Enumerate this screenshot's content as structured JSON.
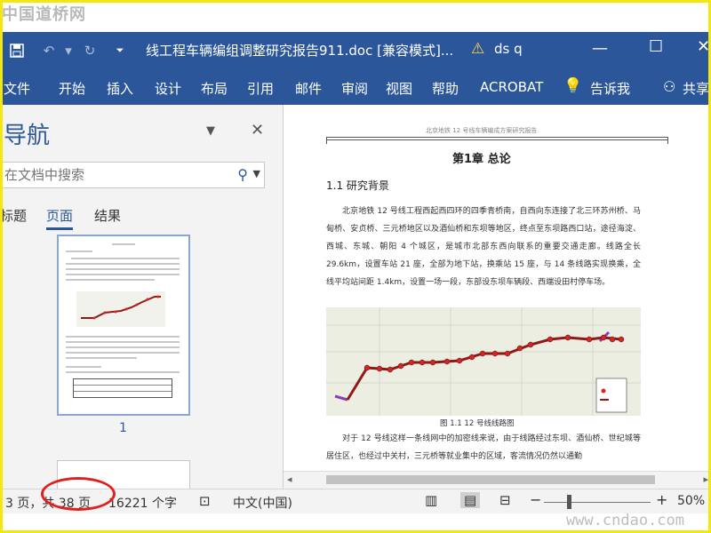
{
  "watermarks": {
    "top_left": "中国道桥网",
    "bottom_right": "www.cndao.com"
  },
  "titlebar": {
    "title": "线工程车辆编组调整研究报告911.doc [兼容模式]...",
    "user": "ds q",
    "qat": [
      "save-icon",
      "undo-icon",
      "redo-icon",
      "customize-icon"
    ]
  },
  "ribbon": {
    "tabs": [
      "文件",
      "开始",
      "插入",
      "设计",
      "布局",
      "引用",
      "邮件",
      "审阅",
      "视图",
      "帮助",
      "ACROBAT",
      "告诉我",
      "共享"
    ]
  },
  "nav": {
    "title": "导航",
    "search_placeholder": "在文档中搜索",
    "tabs": [
      "标题",
      "页面",
      "结果"
    ],
    "active_tab": "页面",
    "thumbnail_page_number": "1"
  },
  "document": {
    "header": "北京地铁 12 号线车辆编成方案研究报告",
    "chapter": "第1章 总论",
    "section": "1.1 研究背景",
    "para1": "北京地铁 12 号线工程西起西四环的四季青桥南，自西向东连接了北三环苏州桥、马甸桥、安贞桥、三元桥地区以及酒仙桥和东坝等地区，终点至东坝路西口站，途径海淀、西城、东城、朝阳 4 个城区，是城市北部东西向联系的重要交通走廊。线路全长 29.6km，设置车站 21 座，全部为地下站，换乘站 15 座，与 14 条线路实现换乘，全线平均站间距 1.4km，设置一场一段，东部设东坝车辆段、西端设田村停车场。",
    "figure_caption": "图 1.1   12 号线线路图",
    "para2": "对于 12 号线这样一条线网中的加密线来说，由于线路经过东坝、酒仙桥、世纪城等居住区，也经过中关村，三元桥等就业集中的区域，客流情况仍然以通勤"
  },
  "status": {
    "page": "3 页，共 38 页",
    "words": "16221 个字",
    "language": "中文(中国)",
    "zoom": "50%",
    "zoom_level": 0.5
  },
  "colors": {
    "accent": "#2b579a",
    "line": "#8e1a1a",
    "station": "#e02020",
    "annotation": "#e02020"
  }
}
